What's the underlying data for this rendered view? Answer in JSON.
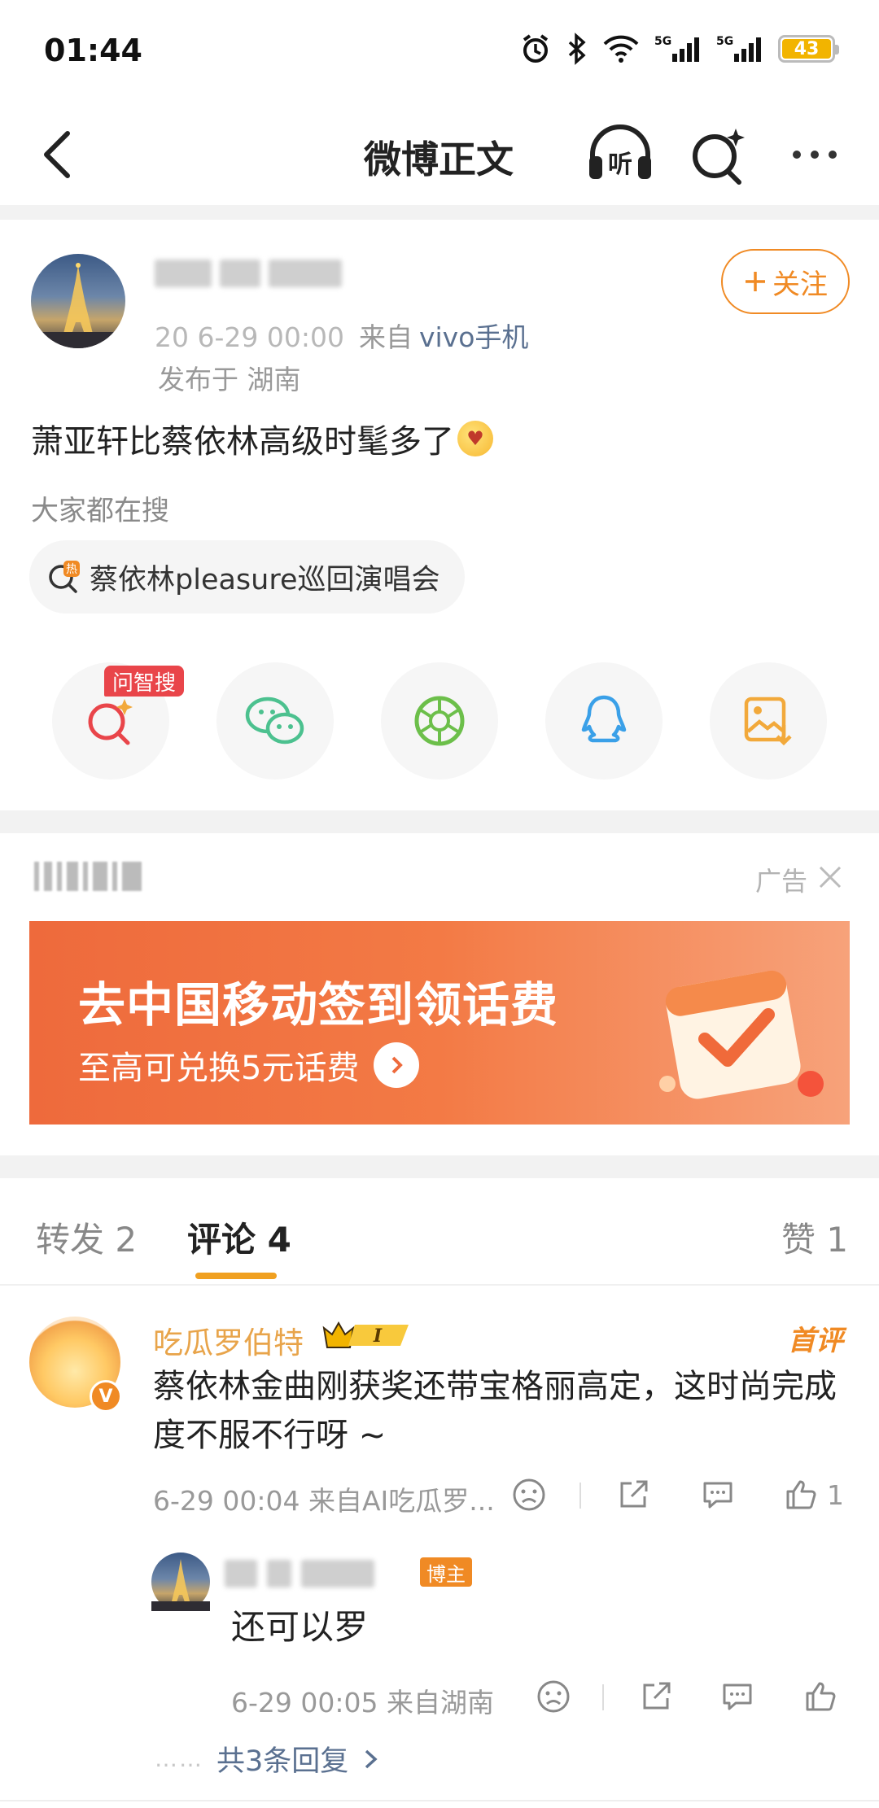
{
  "status_bar": {
    "time": "01:44",
    "battery": "43",
    "net1": "5G",
    "net2": "5G",
    "icons": [
      "alarm-icon",
      "bluetooth-icon",
      "wifi-icon",
      "signal-icon",
      "battery-icon"
    ]
  },
  "nav": {
    "title": "微博正文",
    "listen_label": "听",
    "icons": [
      "back-icon",
      "listen-icon",
      "ai-search-icon",
      "more-icon"
    ]
  },
  "post": {
    "meta_date": "20 6-29 00:00",
    "meta_from": "来自",
    "meta_device": "vivo手机",
    "location": "发布于 湖南",
    "follow_label": "关注",
    "text": "萧亚轩比蔡依林高级时髦多了",
    "search_hint": "大家都在搜",
    "hot_search": "蔡依林pleasure巡回演唱会",
    "hot_tag": "热"
  },
  "share": {
    "ai_badge": "问智搜",
    "items": [
      "ai-search-icon",
      "wechat-icon",
      "moments-icon",
      "qq-icon",
      "save-image-icon"
    ],
    "colors": {
      "ai": "#e9454a",
      "wechat": "#4cc18f",
      "moments": "#6cbf4a",
      "qq": "#3aa0e8",
      "save": "#f2a93b"
    }
  },
  "ad": {
    "label": "广告",
    "title": "去中国移动签到领话费",
    "subtitle": "至高可兑换5元话费"
  },
  "tabs": {
    "repost": "转发 2",
    "comment": "评论 4",
    "like": "赞 1"
  },
  "comment": {
    "name": "吃瓜罗伯特",
    "level": "I",
    "v_badge": "V",
    "first_label": "首评",
    "text": "蔡依林金曲刚获奖还带宝格丽高定，这时尚完成度不服不行呀 ~",
    "meta": "6-29 00:04  来自AI吃瓜罗...",
    "like_count": "1"
  },
  "reply": {
    "owner_badge": "博主",
    "text": "还可以罗",
    "meta": "6-29 00:05  来自湖南",
    "more_dots": "……",
    "more_label": "共3条回复"
  }
}
